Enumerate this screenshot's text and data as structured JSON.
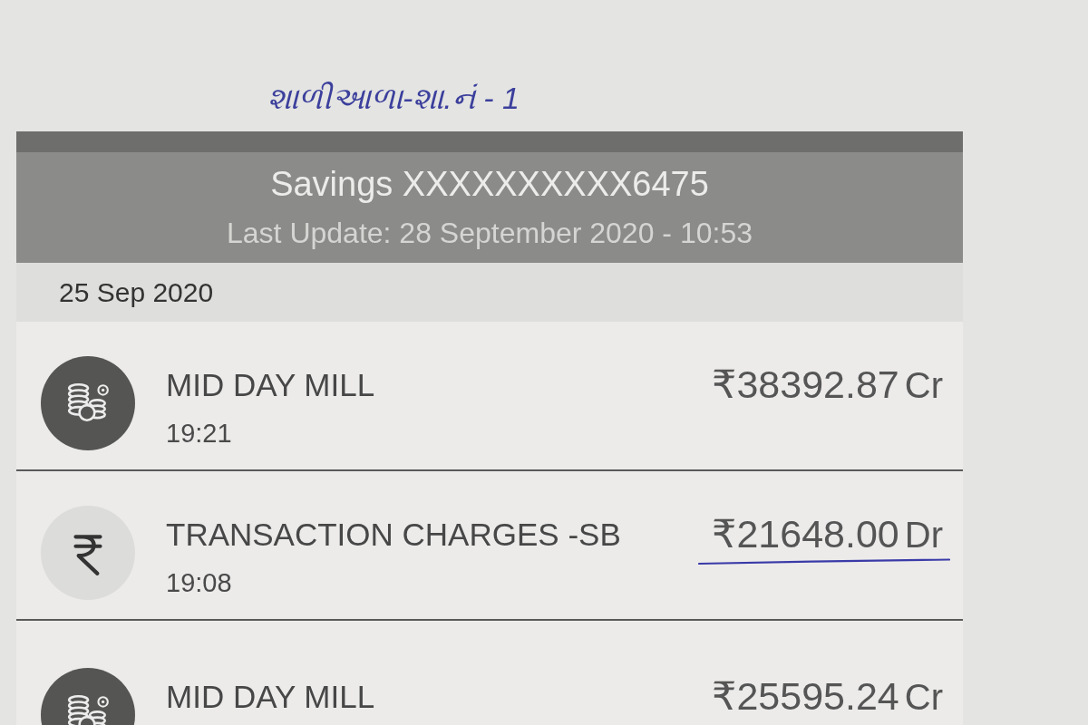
{
  "note": "શાળીઆળા-શા.નં - 1",
  "account": {
    "title": "Savings XXXXXXXXXX6475",
    "last_update": "Last Update: 28 September 2020 - 10:53"
  },
  "date_header": "25 Sep 2020",
  "transactions": [
    {
      "kind": "coins",
      "title": "MID DAY MILL",
      "time": "19:21",
      "amount": "₹38392.87",
      "type": "Cr",
      "underlined": false
    },
    {
      "kind": "rupee",
      "title": "TRANSACTION CHARGES -SB",
      "time": "19:08",
      "amount": "₹21648.00",
      "type": "Dr",
      "underlined": true
    },
    {
      "kind": "coins",
      "title": "MID DAY MILL",
      "amount": "₹25595.24",
      "type": "Cr",
      "underlined": false
    }
  ]
}
